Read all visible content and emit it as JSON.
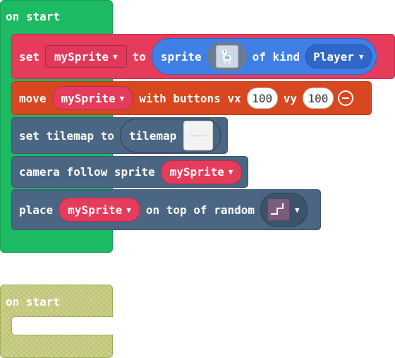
{
  "hat": {
    "label": "on start"
  },
  "set_block": {
    "keyword": "set",
    "variable": "mySprite",
    "to_label": "to",
    "sprite_label": "sprite",
    "image_icon": "llama-sprite-image",
    "kind_label": "of kind",
    "kind_value": "Player"
  },
  "move_block": {
    "keyword": "move",
    "variable": "mySprite",
    "with_label": "with buttons vx",
    "vx": "100",
    "vy_label": "vy",
    "vy": "100",
    "collapse_icon": "minus-circle-icon"
  },
  "tilemap_block": {
    "label": "set tilemap to",
    "reporter_label": "tilemap",
    "image_icon": "blank-tilemap-image"
  },
  "camera_block": {
    "label": "camera follow sprite",
    "variable": "mySprite"
  },
  "place_block": {
    "keyword": "place",
    "variable": "mySprite",
    "label": "on top of random",
    "image_icon": "tile-image"
  },
  "disabled_hat": {
    "label": "on start"
  },
  "colors": {
    "hat": "#1cba63",
    "sprites": "#e63c5c",
    "controller": "#d8471f",
    "scene": "#4b6683",
    "sprite_reporter": "#3f7fe6",
    "disabled": "#cfcf8a"
  }
}
